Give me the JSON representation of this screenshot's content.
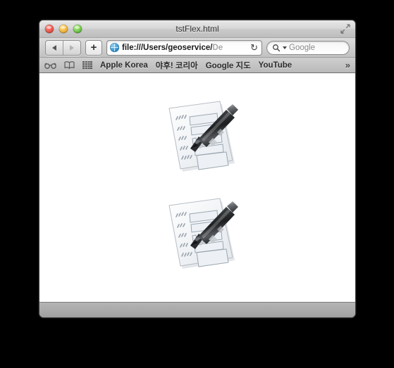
{
  "window": {
    "title": "tstFlex.html",
    "traffic_lights": [
      {
        "name": "close",
        "color": "#e24b40"
      },
      {
        "name": "minimize",
        "color": "#efac2c"
      },
      {
        "name": "zoom",
        "color": "#5fbd3e"
      }
    ],
    "fullscreen_icon": "fullscreen-arrows-icon"
  },
  "toolbar": {
    "back_label": "",
    "forward_label": "",
    "add_tab_label": "+",
    "url_value": "file:///Users/geoservice/De",
    "url_visible_text": "file:///Users/geoservice/",
    "url_truncated_text": "De",
    "reload_label": "↻",
    "search_placeholder": "Google",
    "search_value": ""
  },
  "bookmarks_bar": {
    "icons": [
      {
        "name": "reader-glasses-icon"
      },
      {
        "name": "bookmarks-book-icon"
      },
      {
        "name": "top-sites-grid-icon"
      }
    ],
    "items": [
      {
        "label": "Apple Korea"
      },
      {
        "label": "야후! 코리아"
      },
      {
        "label": "Google 지도"
      },
      {
        "label": "YouTube"
      }
    ],
    "overflow_label": "»"
  },
  "content": {
    "background_color": "#ffffff",
    "items": [
      {
        "name": "form-with-pen-icon",
        "alt": "Form document with fountain pen"
      },
      {
        "name": "form-with-pen-icon",
        "alt": "Form document with fountain pen"
      }
    ]
  },
  "status_bar": {
    "text": ""
  }
}
